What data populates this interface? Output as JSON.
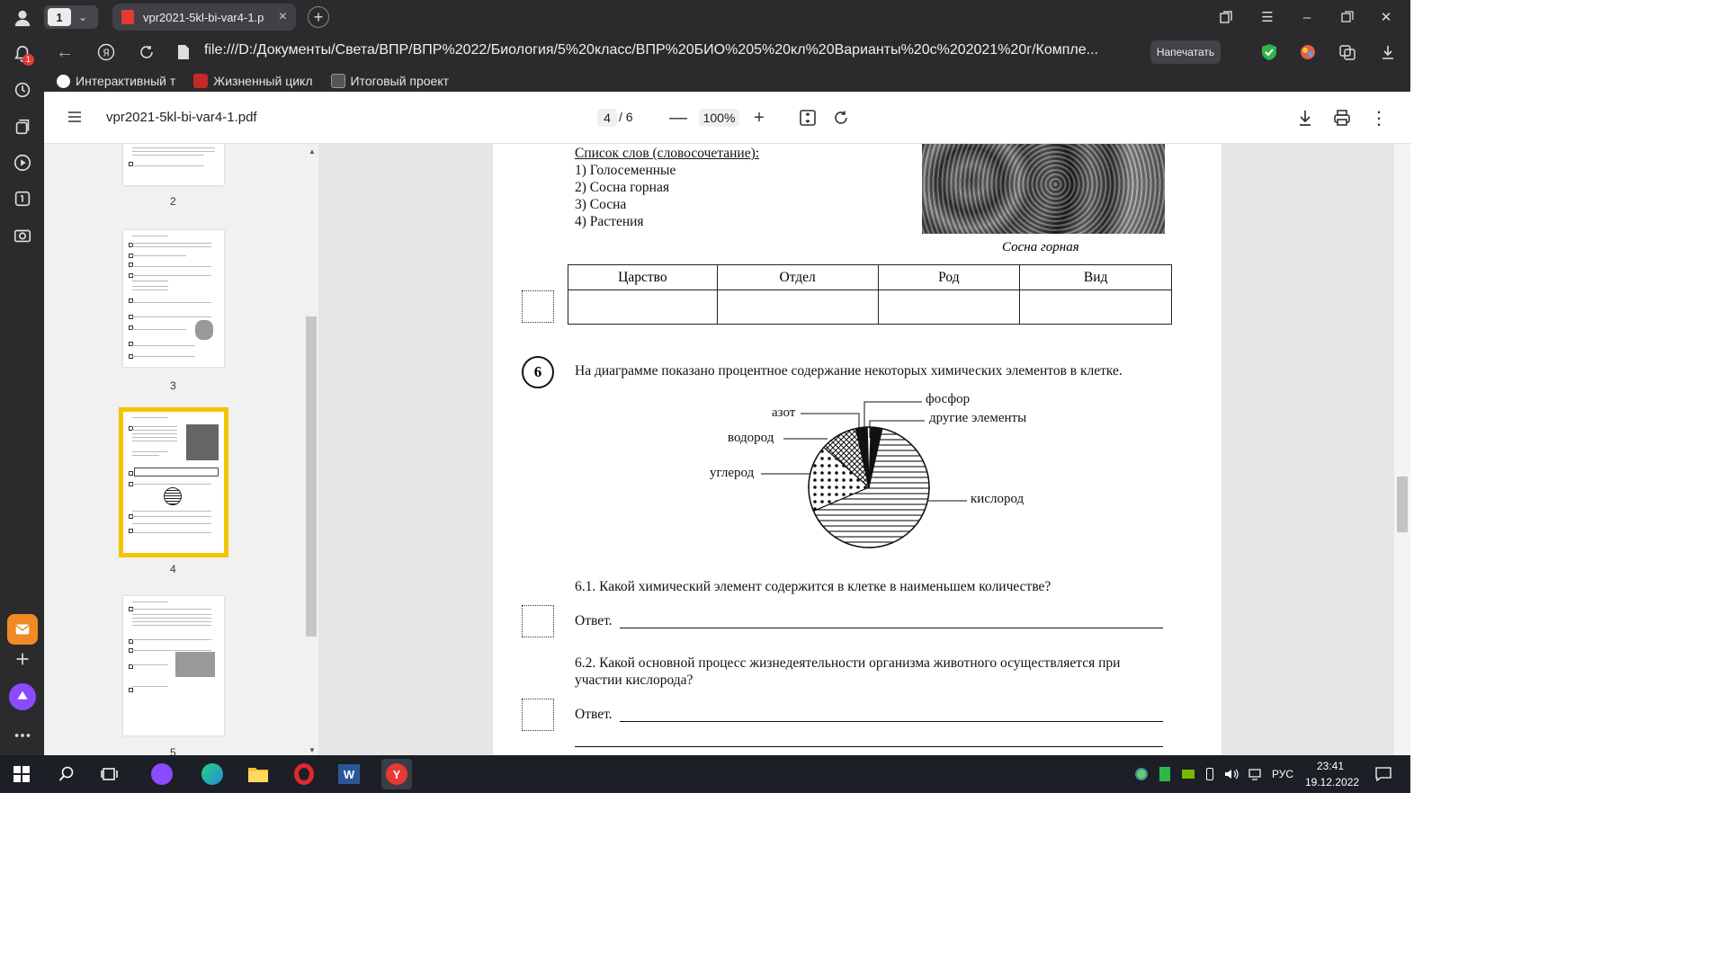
{
  "browser": {
    "tab_count": "1",
    "tab_title": "vpr2021-5kl-bi-var4-1.p",
    "url": "file:///D:/Документы/Света/ВПР/ВПР%2022/Биология/5%20класс/ВПР%20БИО%205%20кл%20Варианты%20с%202021%20г/Компле...",
    "print_label": "Напечатать",
    "notification_count": "1",
    "bookmarks": [
      {
        "label": "Интерактивный т",
        "icon": "bookmark-app-icon"
      },
      {
        "label": "Жизненный цикл",
        "icon": "bookmark-game-icon"
      },
      {
        "label": "Итоговый проект",
        "icon": "bookmark-doc-icon"
      }
    ]
  },
  "pdf_toolbar": {
    "file_name": "vpr2021-5kl-bi-var4-1.pdf",
    "current_page": "4",
    "page_total": "/ 6",
    "zoom": "100%"
  },
  "thumbnails": {
    "labels": [
      "2",
      "3",
      "4",
      "5"
    ],
    "selected": "4"
  },
  "document": {
    "word_list_heading": "Список слов (словосочетание):",
    "word_list": [
      "1) Голосеменные",
      "2) Сосна горная",
      "3) Сосна",
      "4) Растения"
    ],
    "image_caption": "Сосна горная",
    "table_headers": [
      "Царство",
      "Отдел",
      "Род",
      "Вид"
    ],
    "q6_number": "6",
    "q6_text": "На диаграмме показано процентное содержание некоторых химических элементов в клетке.",
    "pie_labels": {
      "nitrogen": "азот",
      "phosphorus": "фосфор",
      "other": "другие элементы",
      "hydrogen": "водород",
      "carbon": "углерод",
      "oxygen": "кислород"
    },
    "q61_text": "6.1. Какой химический элемент содержится в клетке в наименьшем количестве?",
    "answer_label": "Ответ.",
    "q62_text_line1": "6.2. Какой основной процесс жизнедеятельности организма животного осуществляется при",
    "q62_text_line2": "участии кислорода?"
  },
  "chart_data": {
    "type": "pie",
    "categories": [
      "кислород",
      "углерод",
      "водород",
      "азот",
      "фосфор",
      "другие элементы"
    ],
    "values": [
      65,
      18,
      10,
      3,
      1,
      3
    ],
    "fills": [
      "horizontal-lines",
      "dots",
      "crosshatch",
      "solid-black",
      "white",
      "solid-black"
    ]
  },
  "taskbar": {
    "lang": "РУС",
    "time": "23:41",
    "date": "19.12.2022"
  },
  "colors": {
    "chrome_bg": "#2b2b2e",
    "selected_thumb": "#f5c400",
    "taskbar_bg": "#1c1f26"
  }
}
